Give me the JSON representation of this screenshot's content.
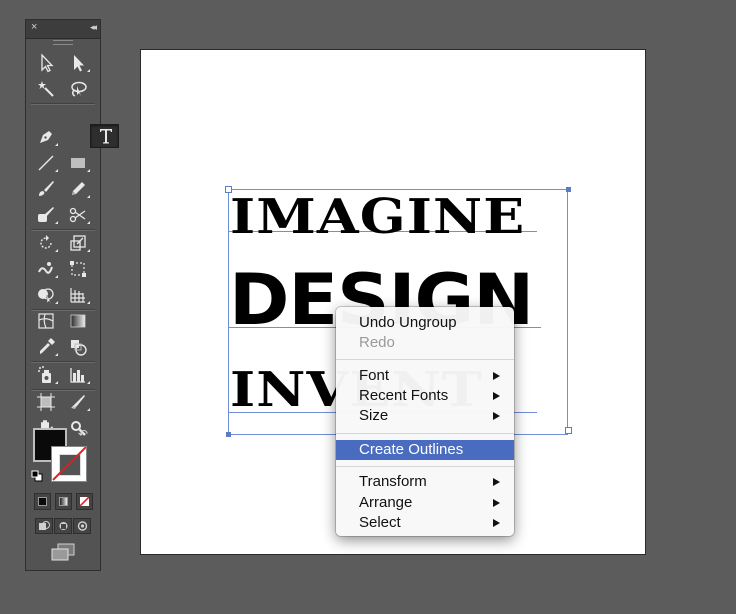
{
  "tools_panel": {
    "close_glyph": "×",
    "collapse_glyph": "◂◂",
    "tools": [
      {
        "name": "selection-tool",
        "icon": "arrow-icon"
      },
      {
        "name": "direct-selection-tool",
        "icon": "white-arrow-icon"
      },
      {
        "name": "magic-wand-tool",
        "icon": "magic-wand-icon"
      },
      {
        "name": "lasso-tool",
        "icon": "lasso-icon"
      },
      {
        "name": "pen-tool",
        "icon": "pen-icon"
      },
      {
        "name": "type-tool",
        "icon": "type-icon",
        "active": true
      },
      {
        "name": "line-segment-tool",
        "icon": "line-icon"
      },
      {
        "name": "rectangle-tool",
        "icon": "rectangle-icon"
      },
      {
        "name": "paintbrush-tool",
        "icon": "brush-icon"
      },
      {
        "name": "pencil-tool",
        "icon": "pencil-icon"
      },
      {
        "name": "blob-brush-tool",
        "icon": "blob-brush-icon"
      },
      {
        "name": "scissors-tool",
        "icon": "scissors-icon"
      },
      {
        "name": "rotate-tool",
        "icon": "rotate-icon"
      },
      {
        "name": "scale-tool",
        "icon": "scale-icon"
      },
      {
        "name": "warp-tool",
        "icon": "warp-icon"
      },
      {
        "name": "free-transform-tool",
        "icon": "free-transform-icon"
      },
      {
        "name": "shape-builder-tool",
        "icon": "shape-builder-icon"
      },
      {
        "name": "perspective-grid-tool",
        "icon": "perspective-grid-icon"
      },
      {
        "name": "mesh-tool",
        "icon": "mesh-icon"
      },
      {
        "name": "gradient-tool",
        "icon": "gradient-icon"
      },
      {
        "name": "eyedropper-tool",
        "icon": "eyedropper-icon"
      },
      {
        "name": "blend-tool",
        "icon": "blend-icon"
      },
      {
        "name": "symbol-sprayer-tool",
        "icon": "symbol-sprayer-icon"
      },
      {
        "name": "column-graph-tool",
        "icon": "column-graph-icon"
      },
      {
        "name": "artboard-tool",
        "icon": "artboard-icon"
      },
      {
        "name": "slice-tool",
        "icon": "slice-icon"
      },
      {
        "name": "hand-tool",
        "icon": "hand-icon"
      },
      {
        "name": "zoom-tool",
        "icon": "zoom-icon"
      }
    ],
    "colors": {
      "fill": "#0a0a0a",
      "stroke": "none",
      "accent_red": "#e02020"
    }
  },
  "artboard": {
    "lines": [
      "IMAGINE",
      "DESIGN",
      "INVENT"
    ],
    "selection_color": "#6f8fd6"
  },
  "context_menu": {
    "items": [
      {
        "label": "Undo Ungroup",
        "enabled": true
      },
      {
        "label": "Redo",
        "enabled": false
      },
      {
        "label": "Font",
        "submenu": true
      },
      {
        "label": "Recent Fonts",
        "submenu": true
      },
      {
        "label": "Size",
        "submenu": true
      },
      {
        "label": "Create Outlines",
        "highlighted": true
      },
      {
        "label": "Transform",
        "submenu": true
      },
      {
        "label": "Arrange",
        "submenu": true
      },
      {
        "label": "Select",
        "submenu": true
      }
    ],
    "highlight_color": "#4a6cc0"
  }
}
